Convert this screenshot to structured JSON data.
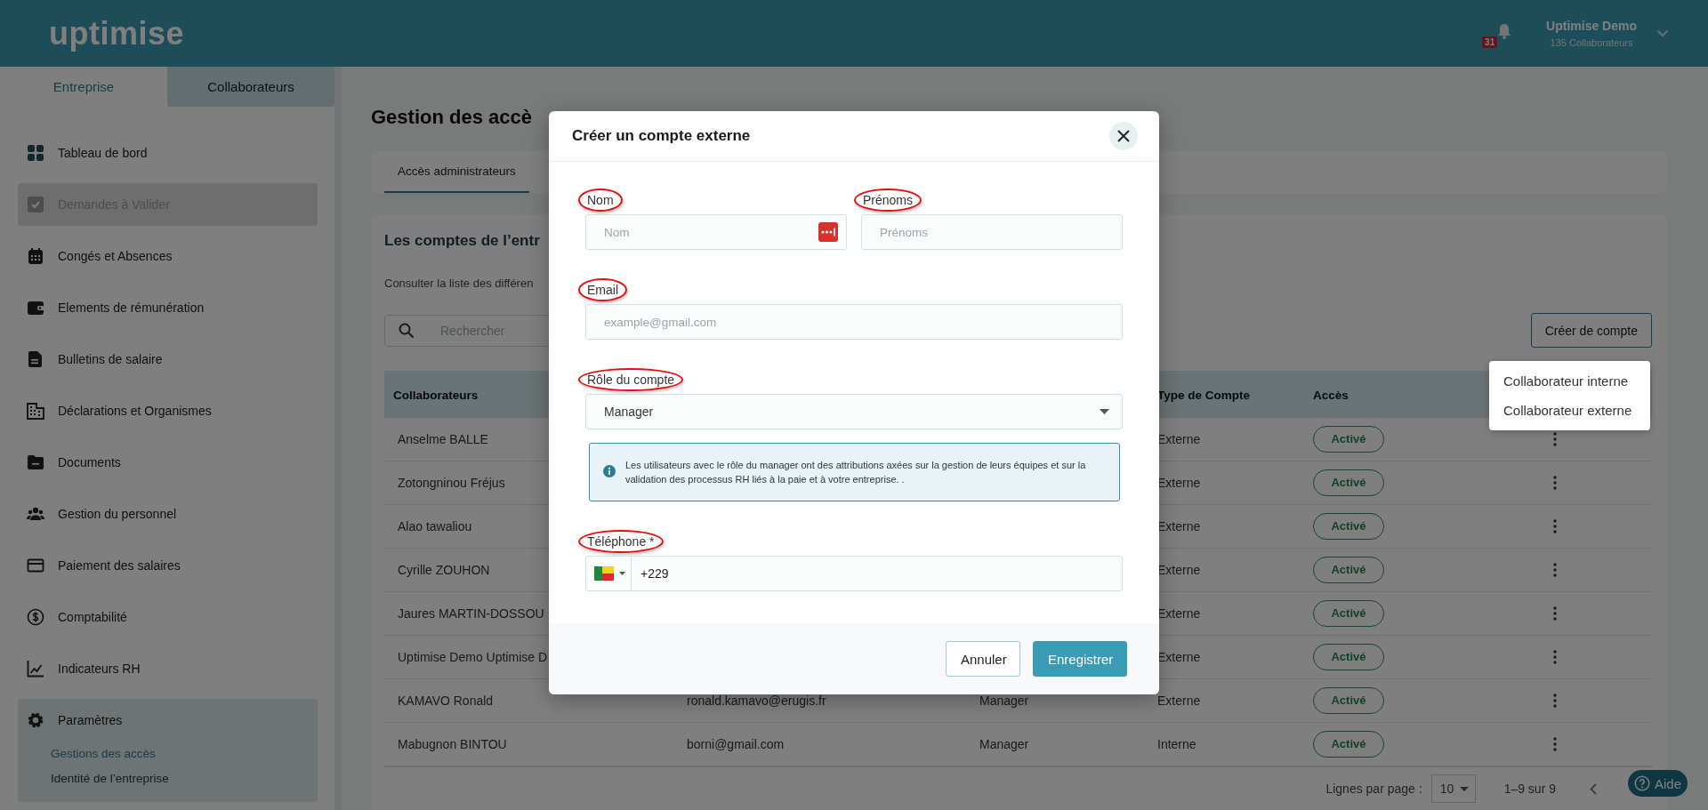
{
  "header": {
    "logo": "uptimise",
    "notification_count": "31",
    "account_name": "Uptimise Demo",
    "account_subtitle": "135 Collaborateurs"
  },
  "sidebar": {
    "tabs": [
      {
        "label": "Entreprise",
        "selected": true
      },
      {
        "label": "Collaborateurs",
        "selected": false
      }
    ],
    "items": [
      {
        "label": "Tableau de bord",
        "disabled": false,
        "expanded": false
      },
      {
        "label": "Demandes à Valider",
        "disabled": true,
        "expanded": false
      },
      {
        "label": "Congés et Absences",
        "disabled": false,
        "expanded": false
      },
      {
        "label": "Elements de rémunération",
        "disabled": false,
        "expanded": false
      },
      {
        "label": "Bulletins de salaire",
        "disabled": false,
        "expanded": false
      },
      {
        "label": "Déclarations et Organismes",
        "disabled": false,
        "expanded": false
      },
      {
        "label": "Documents",
        "disabled": false,
        "expanded": false
      },
      {
        "label": "Gestion du personnel",
        "disabled": false,
        "expanded": false
      },
      {
        "label": "Paiement des salaires",
        "disabled": false,
        "expanded": false
      },
      {
        "label": "Comptabilité",
        "disabled": false,
        "expanded": false
      },
      {
        "label": "Indicateurs RH",
        "disabled": false,
        "expanded": false
      },
      {
        "label": "Paramètres",
        "disabled": false,
        "expanded": true,
        "children": [
          {
            "label": "Gestions des accès",
            "selected": true
          },
          {
            "label": "Identité de l’entreprise",
            "selected": false
          }
        ]
      }
    ]
  },
  "page": {
    "title": "Gestion des accè",
    "tabs": [
      {
        "label": "Accès administrateurs",
        "selected": true
      }
    ],
    "section_title": "Les comptes de l’entr",
    "section_subtitle": "Consulter la liste des différen",
    "search": {
      "placeholder": "Rechercher"
    },
    "create_button": "Créer de compte",
    "create_menu": [
      {
        "label": "Collaborateur interne"
      },
      {
        "label": "Collaborateur externe"
      }
    ],
    "table": {
      "header": {
        "collaborator": "Collaborateurs",
        "type": "Type de Compte",
        "access": "Accès"
      },
      "rows": [
        {
          "collaborator": "Anselme BALLE",
          "type": "Externe",
          "access": "Activé"
        },
        {
          "collaborator": "Zotongninou Fréjus",
          "type": "Externe",
          "access": "Activé"
        },
        {
          "collaborator": "Alao tawaliou",
          "type": "Externe",
          "access": "Activé"
        },
        {
          "collaborator": "Cyrille ZOUHON",
          "type": "Externe",
          "access": "Activé"
        },
        {
          "collaborator": "Jaures MARTIN-DOSSOU",
          "type": "Externe",
          "access": "Activé"
        },
        {
          "collaborator": "Uptimise Demo Uptimise D",
          "type": "Externe",
          "access": "Activé"
        },
        {
          "collaborator": "KAMAVO Ronald",
          "email": "ronald.kamavo@erugis.fr",
          "role": "Manager",
          "type": "Externe",
          "access": "Activé"
        },
        {
          "collaborator": "Mabugnon BINTOU",
          "email": "borni@gmail.com",
          "role": "Manager",
          "type": "Interne",
          "access": "Activé"
        }
      ]
    },
    "pagination": {
      "rows_per_page_label": "Lignes par page :",
      "rows_per_page": "10",
      "range": "1–9 sur 9"
    }
  },
  "help_button": "Aide",
  "modal": {
    "title": "Créer un compte externe",
    "rows": [
      [
        {
          "kind": "text",
          "label": "Nom",
          "placeholder": "Nom",
          "circled": true,
          "autofill": true
        },
        {
          "kind": "text",
          "label": "Prénoms",
          "placeholder": "Prénoms",
          "circled": true,
          "autofill": false
        }
      ],
      [
        {
          "kind": "text",
          "label": "Email",
          "placeholder": "example@gmail.com",
          "circled": true,
          "autofill": false
        }
      ],
      [
        {
          "kind": "select",
          "label": "Rôle du compte",
          "value": "Manager",
          "circled": true,
          "note": "Les utilisateurs avec le rôle du manager ont des attributions axées sur la gestion de leurs équipes et sur la validation des processus RH liés à la paie et à votre entreprise. ."
        }
      ],
      [
        {
          "kind": "phone",
          "label": "Téléphone *",
          "value": "+229",
          "circled": true
        }
      ]
    ],
    "buttons": [
      {
        "label": "Annuler",
        "kind": "secondary"
      },
      {
        "label": "Enregistrer",
        "kind": "primary"
      }
    ]
  }
}
